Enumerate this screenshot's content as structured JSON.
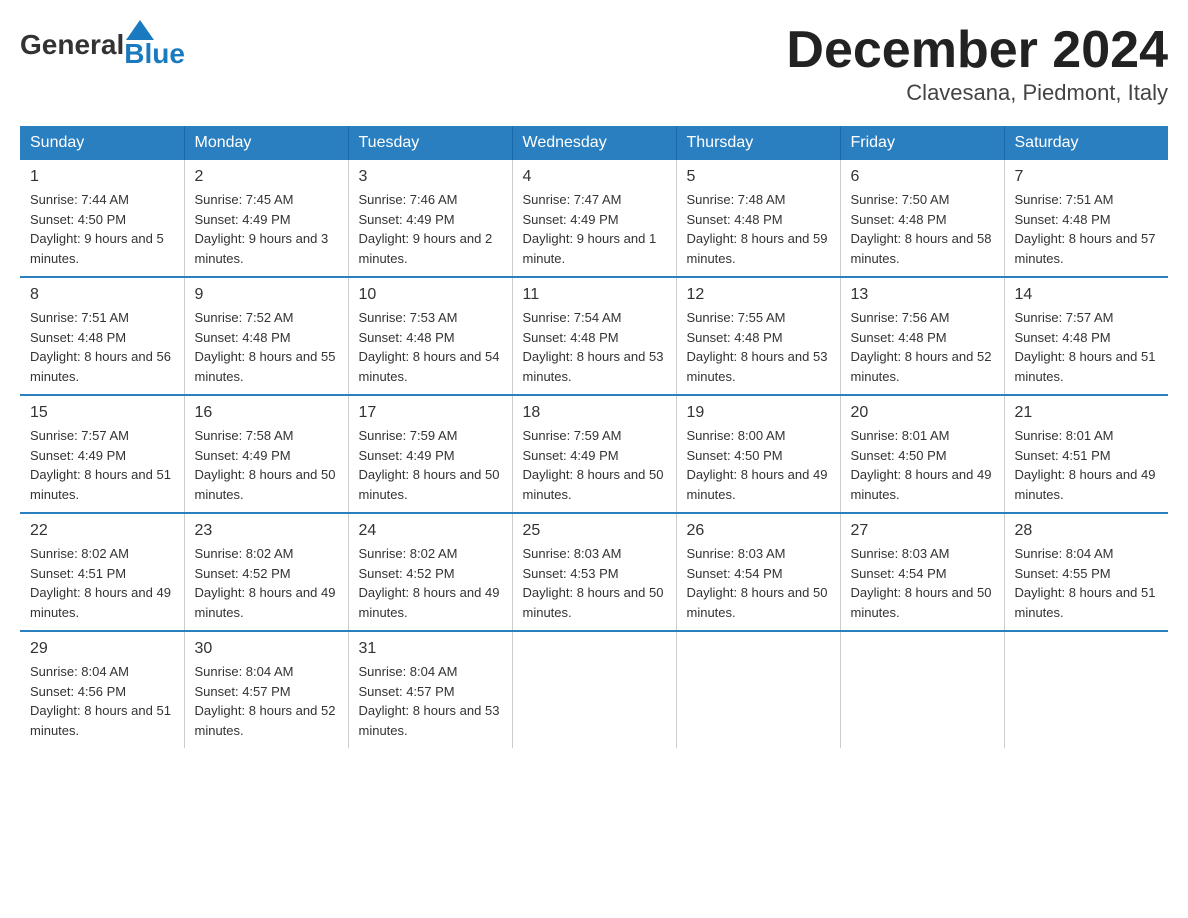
{
  "header": {
    "logo_general": "General",
    "logo_blue": "Blue",
    "month_title": "December 2024",
    "location": "Clavesana, Piedmont, Italy"
  },
  "days_of_week": [
    "Sunday",
    "Monday",
    "Tuesday",
    "Wednesday",
    "Thursday",
    "Friday",
    "Saturday"
  ],
  "weeks": [
    [
      {
        "day": "1",
        "sunrise": "7:44 AM",
        "sunset": "4:50 PM",
        "daylight": "9 hours and 5 minutes."
      },
      {
        "day": "2",
        "sunrise": "7:45 AM",
        "sunset": "4:49 PM",
        "daylight": "9 hours and 3 minutes."
      },
      {
        "day": "3",
        "sunrise": "7:46 AM",
        "sunset": "4:49 PM",
        "daylight": "9 hours and 2 minutes."
      },
      {
        "day": "4",
        "sunrise": "7:47 AM",
        "sunset": "4:49 PM",
        "daylight": "9 hours and 1 minute."
      },
      {
        "day": "5",
        "sunrise": "7:48 AM",
        "sunset": "4:48 PM",
        "daylight": "8 hours and 59 minutes."
      },
      {
        "day": "6",
        "sunrise": "7:50 AM",
        "sunset": "4:48 PM",
        "daylight": "8 hours and 58 minutes."
      },
      {
        "day": "7",
        "sunrise": "7:51 AM",
        "sunset": "4:48 PM",
        "daylight": "8 hours and 57 minutes."
      }
    ],
    [
      {
        "day": "8",
        "sunrise": "7:51 AM",
        "sunset": "4:48 PM",
        "daylight": "8 hours and 56 minutes."
      },
      {
        "day": "9",
        "sunrise": "7:52 AM",
        "sunset": "4:48 PM",
        "daylight": "8 hours and 55 minutes."
      },
      {
        "day": "10",
        "sunrise": "7:53 AM",
        "sunset": "4:48 PM",
        "daylight": "8 hours and 54 minutes."
      },
      {
        "day": "11",
        "sunrise": "7:54 AM",
        "sunset": "4:48 PM",
        "daylight": "8 hours and 53 minutes."
      },
      {
        "day": "12",
        "sunrise": "7:55 AM",
        "sunset": "4:48 PM",
        "daylight": "8 hours and 53 minutes."
      },
      {
        "day": "13",
        "sunrise": "7:56 AM",
        "sunset": "4:48 PM",
        "daylight": "8 hours and 52 minutes."
      },
      {
        "day": "14",
        "sunrise": "7:57 AM",
        "sunset": "4:48 PM",
        "daylight": "8 hours and 51 minutes."
      }
    ],
    [
      {
        "day": "15",
        "sunrise": "7:57 AM",
        "sunset": "4:49 PM",
        "daylight": "8 hours and 51 minutes."
      },
      {
        "day": "16",
        "sunrise": "7:58 AM",
        "sunset": "4:49 PM",
        "daylight": "8 hours and 50 minutes."
      },
      {
        "day": "17",
        "sunrise": "7:59 AM",
        "sunset": "4:49 PM",
        "daylight": "8 hours and 50 minutes."
      },
      {
        "day": "18",
        "sunrise": "7:59 AM",
        "sunset": "4:49 PM",
        "daylight": "8 hours and 50 minutes."
      },
      {
        "day": "19",
        "sunrise": "8:00 AM",
        "sunset": "4:50 PM",
        "daylight": "8 hours and 49 minutes."
      },
      {
        "day": "20",
        "sunrise": "8:01 AM",
        "sunset": "4:50 PM",
        "daylight": "8 hours and 49 minutes."
      },
      {
        "day": "21",
        "sunrise": "8:01 AM",
        "sunset": "4:51 PM",
        "daylight": "8 hours and 49 minutes."
      }
    ],
    [
      {
        "day": "22",
        "sunrise": "8:02 AM",
        "sunset": "4:51 PM",
        "daylight": "8 hours and 49 minutes."
      },
      {
        "day": "23",
        "sunrise": "8:02 AM",
        "sunset": "4:52 PM",
        "daylight": "8 hours and 49 minutes."
      },
      {
        "day": "24",
        "sunrise": "8:02 AM",
        "sunset": "4:52 PM",
        "daylight": "8 hours and 49 minutes."
      },
      {
        "day": "25",
        "sunrise": "8:03 AM",
        "sunset": "4:53 PM",
        "daylight": "8 hours and 50 minutes."
      },
      {
        "day": "26",
        "sunrise": "8:03 AM",
        "sunset": "4:54 PM",
        "daylight": "8 hours and 50 minutes."
      },
      {
        "day": "27",
        "sunrise": "8:03 AM",
        "sunset": "4:54 PM",
        "daylight": "8 hours and 50 minutes."
      },
      {
        "day": "28",
        "sunrise": "8:04 AM",
        "sunset": "4:55 PM",
        "daylight": "8 hours and 51 minutes."
      }
    ],
    [
      {
        "day": "29",
        "sunrise": "8:04 AM",
        "sunset": "4:56 PM",
        "daylight": "8 hours and 51 minutes."
      },
      {
        "day": "30",
        "sunrise": "8:04 AM",
        "sunset": "4:57 PM",
        "daylight": "8 hours and 52 minutes."
      },
      {
        "day": "31",
        "sunrise": "8:04 AM",
        "sunset": "4:57 PM",
        "daylight": "8 hours and 53 minutes."
      },
      null,
      null,
      null,
      null
    ]
  ]
}
